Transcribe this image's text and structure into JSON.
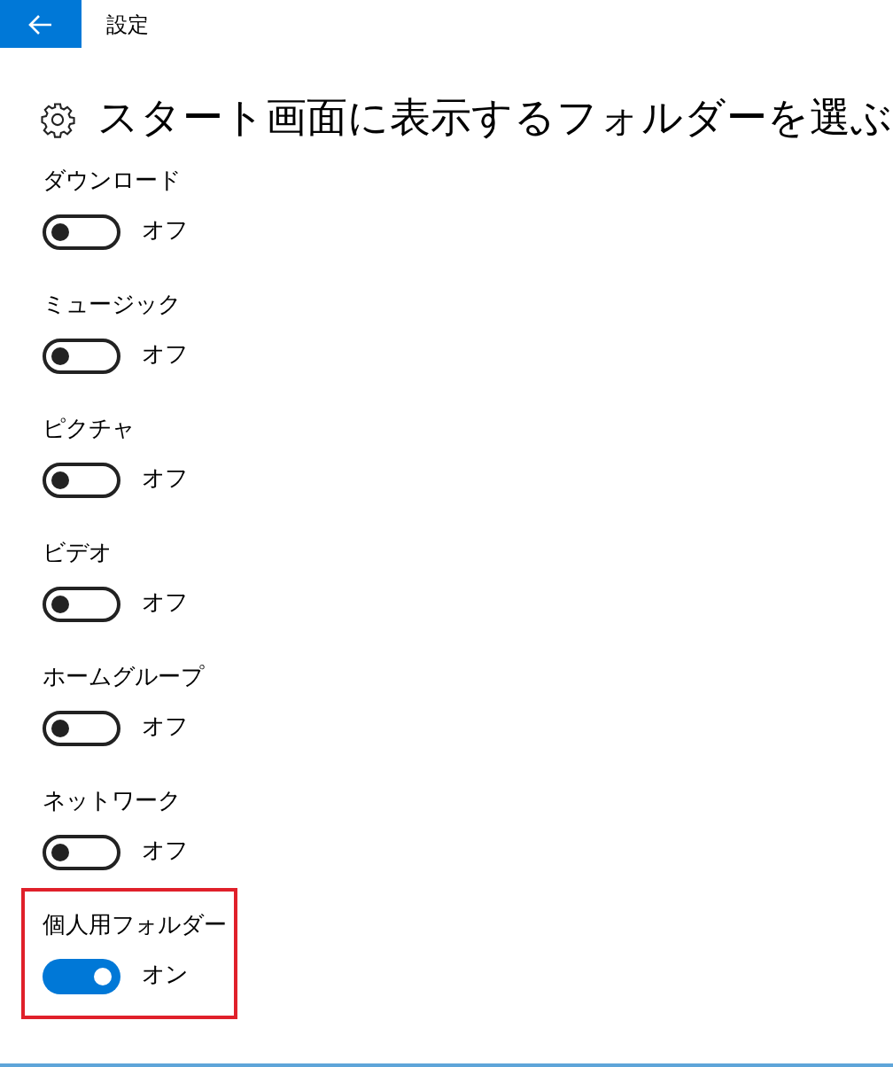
{
  "window": {
    "title": "設定"
  },
  "heading": "スタート画面に表示するフォルダーを選ぶ",
  "folders": [
    {
      "label": "ダウンロード",
      "on": false,
      "state_text": "オフ",
      "highlighted": false
    },
    {
      "label": "ミュージック",
      "on": false,
      "state_text": "オフ",
      "highlighted": false
    },
    {
      "label": "ピクチャ",
      "on": false,
      "state_text": "オフ",
      "highlighted": false
    },
    {
      "label": "ビデオ",
      "on": false,
      "state_text": "オフ",
      "highlighted": false
    },
    {
      "label": "ホームグループ",
      "on": false,
      "state_text": "オフ",
      "highlighted": false
    },
    {
      "label": "ネットワーク",
      "on": false,
      "state_text": "オフ",
      "highlighted": false
    },
    {
      "label": "個人用フォルダー",
      "on": true,
      "state_text": "オン",
      "highlighted": true
    }
  ]
}
